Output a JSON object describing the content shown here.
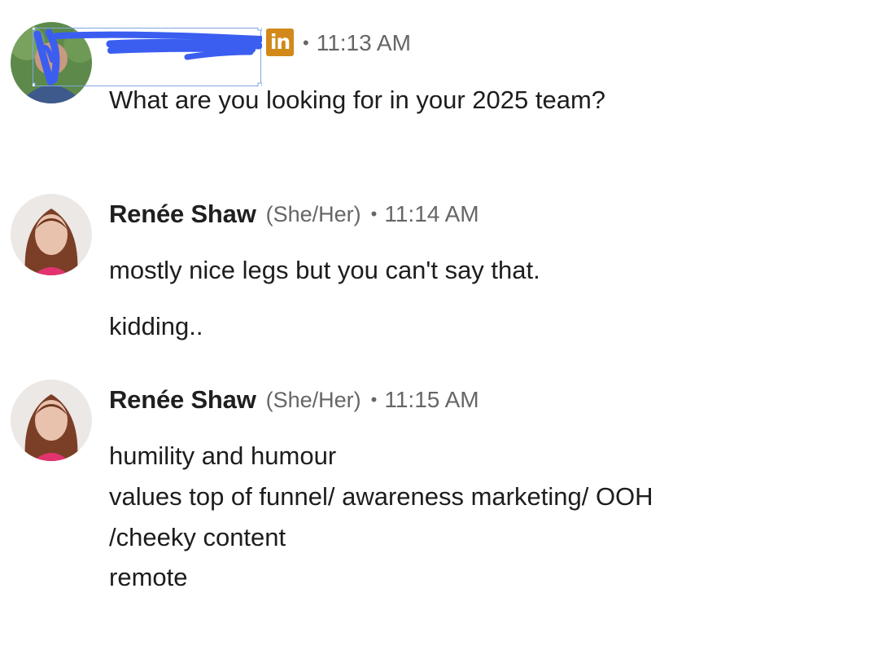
{
  "messages": [
    {
      "sender": "",
      "sender_redacted": true,
      "badge_icon": "linkedin-icon",
      "separator": "•",
      "time": "11:13 AM",
      "lines": [
        "What are you looking for in your 2025 team?"
      ]
    },
    {
      "sender": "Renée Shaw",
      "pronouns": "(She/Her)",
      "separator": "•",
      "time": "11:14 AM",
      "lines": [
        "mostly nice legs but you can't say that.",
        "kidding.."
      ]
    },
    {
      "sender": "Renée Shaw",
      "pronouns": "(She/Her)",
      "separator": "•",
      "time": "11:15 AM",
      "lines": [
        "humility and humour",
        "values top of funnel/ awareness marketing/ OOH",
        "/cheeky content",
        "remote"
      ]
    }
  ],
  "icons": {
    "linkedin_badge_text": "in",
    "linkedin_badge_color": "#d2891a",
    "redaction_color": "#3b5ef0"
  }
}
